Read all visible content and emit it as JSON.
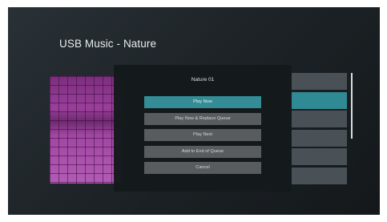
{
  "screen": {
    "title": "USB Music - Nature",
    "list_items": [
      {
        "state": "normal"
      },
      {
        "state": "highlighted"
      },
      {
        "state": "normal"
      },
      {
        "state": "normal"
      },
      {
        "state": "normal"
      },
      {
        "state": "normal"
      }
    ]
  },
  "dialog": {
    "title": "Nature 01",
    "options": [
      {
        "label": "Play Now",
        "selected": true
      },
      {
        "label": "Play Now & Replace Queue",
        "selected": false
      },
      {
        "label": "Play Next",
        "selected": false
      },
      {
        "label": "Add to End of Queue",
        "selected": false
      },
      {
        "label": "Cancel",
        "selected": false
      }
    ]
  },
  "colors": {
    "accent": "#35919a",
    "button": "#5b5e61",
    "album_art": "#9b3f9c"
  }
}
